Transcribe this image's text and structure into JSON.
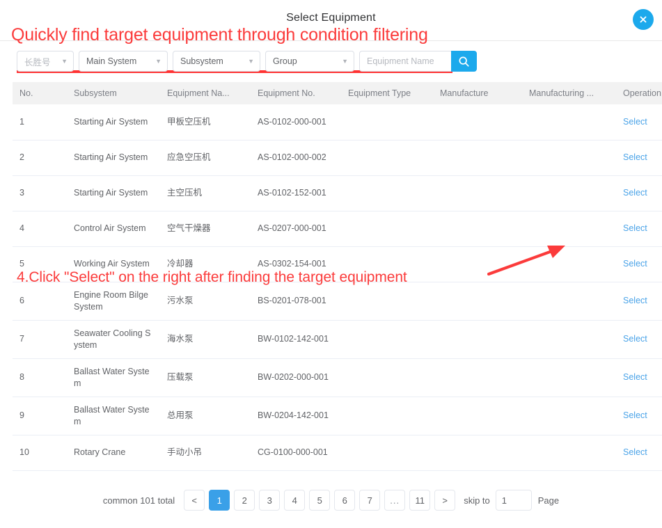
{
  "dialog": {
    "title": "Select Equipment",
    "close_icon": "close-circle-icon"
  },
  "annotations": {
    "heading": "Quickly find target equipment through condition filtering",
    "step4": "4.Click \"Select\" on the right after finding the target equipment",
    "color": "#fb3b3b"
  },
  "filters": {
    "ship": {
      "value": "长胜号",
      "caret": "▼"
    },
    "main_system": {
      "value": "Main System",
      "caret": "▼"
    },
    "subsystem": {
      "value": "Subsystem",
      "caret": "▼"
    },
    "group": {
      "value": "Group",
      "caret": "▼"
    },
    "equipment_name": {
      "value": "",
      "placeholder": "Equipment Name"
    },
    "search_icon": "search-icon"
  },
  "table": {
    "columns": [
      "No.",
      "Subsystem",
      "Equipment Na...",
      "Equipment No.",
      "Equipment Type",
      "Manufacture",
      "Manufacturing ...",
      "Operation"
    ],
    "action_label": "Select",
    "rows": [
      {
        "no": "1",
        "subsystem": "Starting Air System",
        "name": "甲板空压机",
        "eq_no": "AS-0102-000-001",
        "type": "",
        "manufacture": "",
        "mfg_date": ""
      },
      {
        "no": "2",
        "subsystem": "Starting Air System",
        "name": "应急空压机",
        "eq_no": "AS-0102-000-002",
        "type": "",
        "manufacture": "",
        "mfg_date": ""
      },
      {
        "no": "3",
        "subsystem": "Starting Air System",
        "name": "主空压机",
        "eq_no": "AS-0102-152-001",
        "type": "",
        "manufacture": "",
        "mfg_date": ""
      },
      {
        "no": "4",
        "subsystem": "Control Air System",
        "name": "空气干燥器",
        "eq_no": "AS-0207-000-001",
        "type": "",
        "manufacture": "",
        "mfg_date": ""
      },
      {
        "no": "5",
        "subsystem": "Working Air System",
        "name": "冷却器",
        "eq_no": "AS-0302-154-001",
        "type": "",
        "manufacture": "",
        "mfg_date": ""
      },
      {
        "no": "6",
        "subsystem": "Engine Room Bilge System",
        "name": "污水泵",
        "eq_no": "BS-0201-078-001",
        "type": "",
        "manufacture": "",
        "mfg_date": ""
      },
      {
        "no": "7",
        "subsystem": "Seawater Cooling System",
        "name": "海水泵",
        "eq_no": "BW-0102-142-001",
        "type": "",
        "manufacture": "",
        "mfg_date": ""
      },
      {
        "no": "8",
        "subsystem": "Ballast Water System",
        "name": "压载泵",
        "eq_no": "BW-0202-000-001",
        "type": "",
        "manufacture": "",
        "mfg_date": ""
      },
      {
        "no": "9",
        "subsystem": "Ballast Water System",
        "name": "总用泵",
        "eq_no": "BW-0204-142-001",
        "type": "",
        "manufacture": "",
        "mfg_date": ""
      },
      {
        "no": "10",
        "subsystem": "Rotary Crane",
        "name": "手动小吊",
        "eq_no": "CG-0100-000-001",
        "type": "",
        "manufacture": "",
        "mfg_date": ""
      }
    ]
  },
  "pagination": {
    "total_text": "common 101 total",
    "prev": "<",
    "next": ">",
    "pages": [
      "1",
      "2",
      "3",
      "4",
      "5",
      "6",
      "7",
      "...",
      "11"
    ],
    "current": "1",
    "skip_label": "skip to",
    "skip_value": "1",
    "skip_suffix": "Page"
  },
  "colors": {
    "accent": "#1ca9ec",
    "link": "#4aa3e8",
    "annotation_red": "#fb3b3b",
    "header_bg": "#f2f2f2"
  }
}
